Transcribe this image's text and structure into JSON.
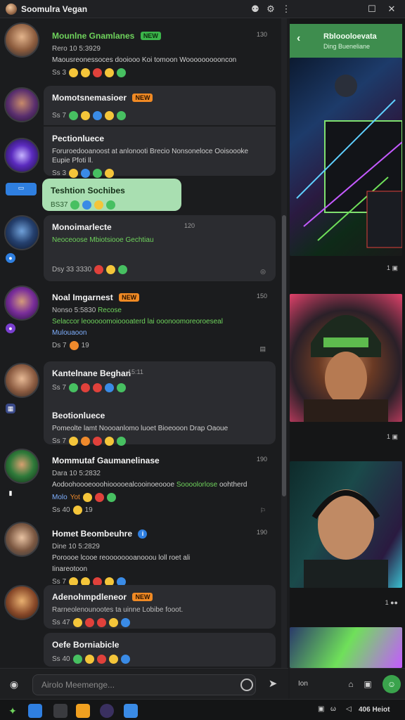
{
  "window": {
    "title": "Soomulra Vegan"
  },
  "chat": {
    "messages": [
      {
        "name": "Mounlne Gnamlanes",
        "badge": "NEW",
        "time": "130",
        "sub": "Rero 10 5:3929",
        "body": "Maousreonessoces dooiooo Koi tomoon Woooooooooncon",
        "count": "Ss 3"
      },
      {
        "name": "Momotsnemasioer",
        "badge": "NEW",
        "time": "",
        "sub": "",
        "body": "",
        "count": "Ss 7"
      },
      {
        "name": "Pectionluece",
        "badge": "",
        "time": "",
        "sub": "",
        "body": "Foruroedooanoost at anlonooti Brecio Nonsoneloce Ooisoooke Eupie Pfoti ll.",
        "count": "Ss 3"
      },
      {
        "name": "Teshtion Sochibes",
        "badge": "",
        "time": "",
        "sub": "",
        "body": "",
        "count": "BS37"
      },
      {
        "name": "Monoimarlecte",
        "badge": "",
        "time": "120",
        "sub": "",
        "body": "Neoceoose Mbiotsiooe Gechtiau",
        "count": "Dsy 33 3330"
      },
      {
        "name": "Noal Imgarnest",
        "badge": "NEW",
        "time": "150",
        "sub": "Nonso 5:5830",
        "sub2": "Recose",
        "body_g": "Selaccor leooooomoioooaterd lai ooonoomoreoroeseal",
        "body_b": "Mulouaoon",
        "count": "Ds 7",
        "count2": "19"
      },
      {
        "name": "Kantelnane Beghan",
        "badge": "",
        "time": "15:11",
        "sub": "Ss 7",
        "body": "",
        "count": ""
      },
      {
        "name": "Beotionluece",
        "badge": "",
        "time": "",
        "sub": "",
        "body": "Pomeolte lamt Noooanlomo luoet Bioeooon Drap Oaoue",
        "count": "Ss 7"
      },
      {
        "name": "Mommutaf Gaumanelinase",
        "badge": "",
        "time": "190",
        "sub": "Dara 10 5:2832",
        "body": "Aodoohoooeooohiooooealcooinoeoooe",
        "body_g": "Soooolorlose",
        "body2": "oohtherd",
        "body_b": "Molo",
        "body_b2": "Yot",
        "count": "Ss 40",
        "count2": "19"
      },
      {
        "name": "Homet Beombeuhre",
        "badge": "",
        "time": "190",
        "sub": "Dine 10 5:2829",
        "body": "Poroooe lcooe reoooooooanooou loll roet ali",
        "body2": "Iinareotoon",
        "count": "Ss 7"
      },
      {
        "name": "Adenohmpdleneor",
        "badge": "NEW",
        "time": "",
        "sub": "Rarneolenounootes ta uinne Lobibe fooot.",
        "body": "",
        "count": "Ss 47"
      },
      {
        "name": "Oefe Borniabicle",
        "badge": "",
        "time": "",
        "sub": "",
        "body": "",
        "count": "Ss 40"
      }
    ],
    "misc": {
      "r1": "",
      "r2": ""
    }
  },
  "side": {
    "header_title": "Rbloooloevata",
    "header_subtitle": "Ding Bueneliane",
    "media_counts": [
      "1",
      "1",
      "1"
    ]
  },
  "composer": {
    "placeholder": "Airolo Meemenge..."
  },
  "side_footer": {
    "label": "Ion"
  },
  "taskbar": {
    "right_text": "406 Heiot"
  },
  "colors": {
    "accent_green": "#3e8d4e",
    "highlight_bubble": "#a9dfb1",
    "badge_orange": "#f08a24",
    "badge_green": "#3bb54a"
  }
}
